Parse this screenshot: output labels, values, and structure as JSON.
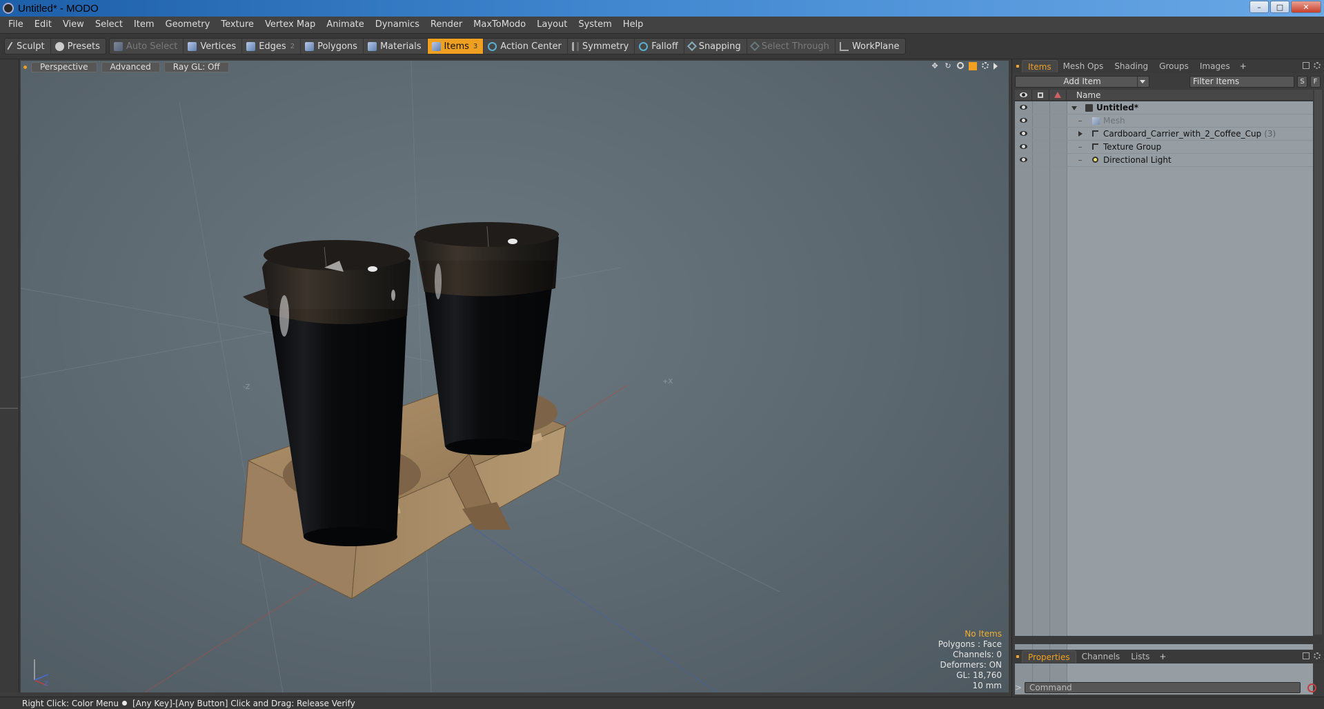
{
  "window": {
    "title": "Untitled* - MODO",
    "minimize": "–",
    "maximize": "□",
    "close": "✕"
  },
  "menu": [
    "File",
    "Edit",
    "View",
    "Select",
    "Item",
    "Geometry",
    "Texture",
    "Vertex Map",
    "Animate",
    "Dynamics",
    "Render",
    "MaxToModo",
    "Layout",
    "System",
    "Help"
  ],
  "toolbar": {
    "sculpt": "Sculpt",
    "presets": "Presets",
    "auto_select": "Auto Select",
    "vertices": "Vertices",
    "edges": "Edges",
    "edges_badge": "2",
    "polygons": "Polygons",
    "materials": "Materials",
    "items": "Items",
    "items_badge": "3",
    "action_center": "Action Center",
    "symmetry": "Symmetry",
    "falloff": "Falloff",
    "snapping": "Snapping",
    "select_through": "Select Through",
    "workplane": "WorkPlane"
  },
  "viewport": {
    "tabs": [
      "Perspective",
      "Advanced",
      "Ray GL: Off"
    ],
    "info": {
      "selection": "No Items",
      "polygons": "Polygons : Face",
      "channels": "Channels: 0",
      "deformers": "Deformers: ON",
      "gl": "GL: 18,760",
      "grid": "10 mm"
    }
  },
  "items_panel": {
    "tabs": [
      "Items",
      "Mesh Ops",
      "Shading",
      "Groups",
      "Images"
    ],
    "plus": "+",
    "add_item": "Add Item",
    "filter_placeholder": "Filter Items",
    "btn_s": "S",
    "btn_f": "F",
    "column_name": "Name",
    "tree": [
      {
        "label": "Untitled*",
        "icon": "scene-icon"
      },
      {
        "label": "Mesh",
        "icon": "mesh-icon"
      },
      {
        "label": "Cardboard_Carrier_with_2_Coffee_Cup",
        "count": "(3)",
        "icon": "group-icon"
      },
      {
        "label": "Texture Group",
        "icon": "texture-group-icon"
      },
      {
        "label": "Directional Light",
        "icon": "light-icon"
      }
    ]
  },
  "properties_panel": {
    "tabs": [
      "Properties",
      "Channels",
      "Lists"
    ],
    "plus": "+"
  },
  "command": {
    "prompt": ">",
    "placeholder": "Command"
  },
  "status": {
    "left": "Right Click: Color Menu",
    "right": "[Any Key]-[Any Button] Click and Drag: Release Verify"
  },
  "colors": {
    "accent": "#f0a020",
    "viewport_bg": "#5c6870",
    "cardboard": "#a88a64",
    "cup": "#0d0f12"
  }
}
